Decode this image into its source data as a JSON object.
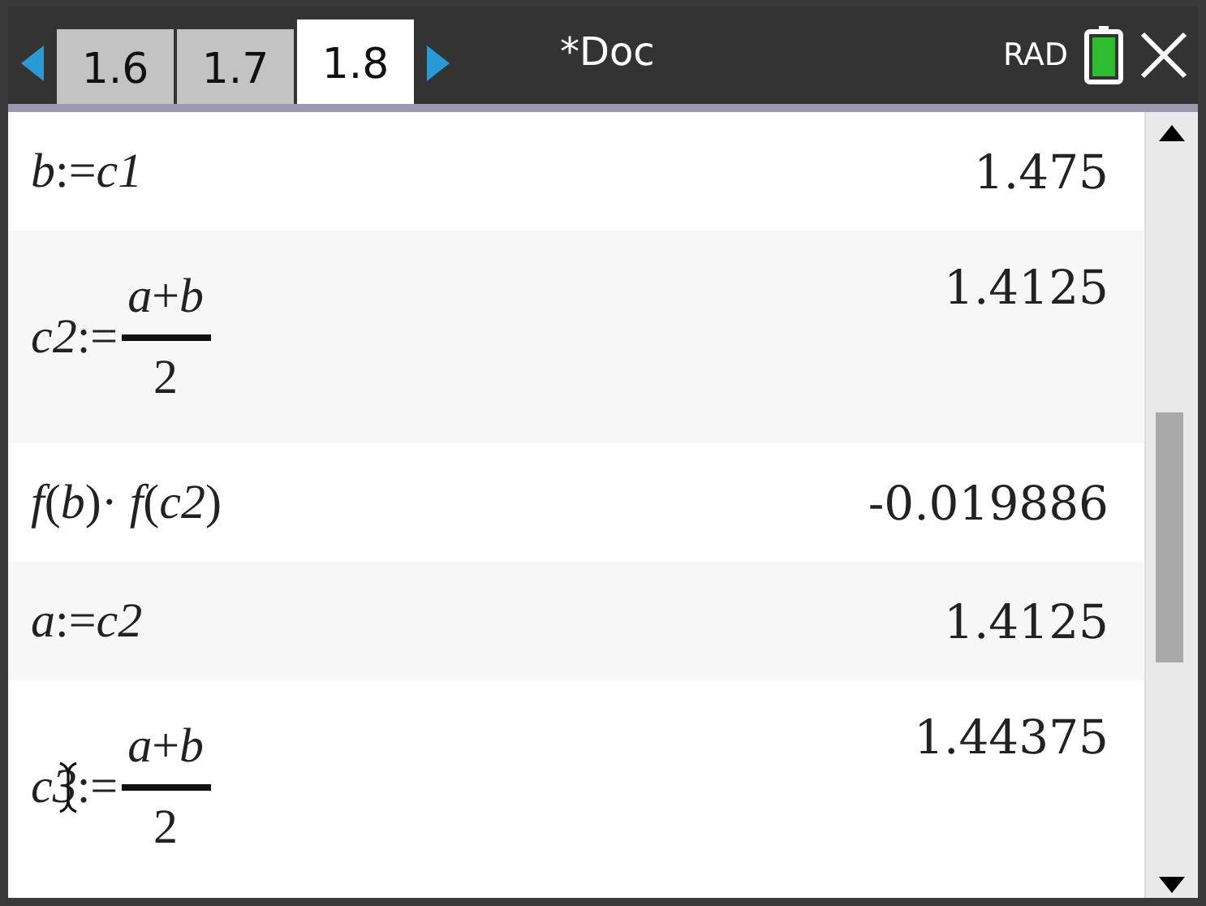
{
  "tabs": [
    {
      "label": "1.6",
      "selected": false
    },
    {
      "label": "1.7",
      "selected": false
    },
    {
      "label": "1.8",
      "selected": true
    }
  ],
  "document": {
    "title": "*Doc",
    "angle_mode": "RAD"
  },
  "entries": [
    {
      "kind": "plain",
      "expression": "*b*:=*c1*",
      "result": "1.475",
      "cursor": false
    },
    {
      "kind": "fraction",
      "lhs": "*c2*:=",
      "numerator": "*a*+*b*",
      "denominator": "2",
      "result": "1.4125",
      "cursor": false
    },
    {
      "kind": "plain",
      "expression": "*f*(*b*)· *f*(*c2*)",
      "result": "-0.019886",
      "cursor": false
    },
    {
      "kind": "plain",
      "expression": "*a*:=*c2*",
      "result": "1.4125",
      "cursor": false
    },
    {
      "kind": "fraction",
      "lhs": "*c3*:=",
      "numerator": "*a*+*b*",
      "denominator": "2",
      "result": "1.44375",
      "cursor": true
    }
  ]
}
